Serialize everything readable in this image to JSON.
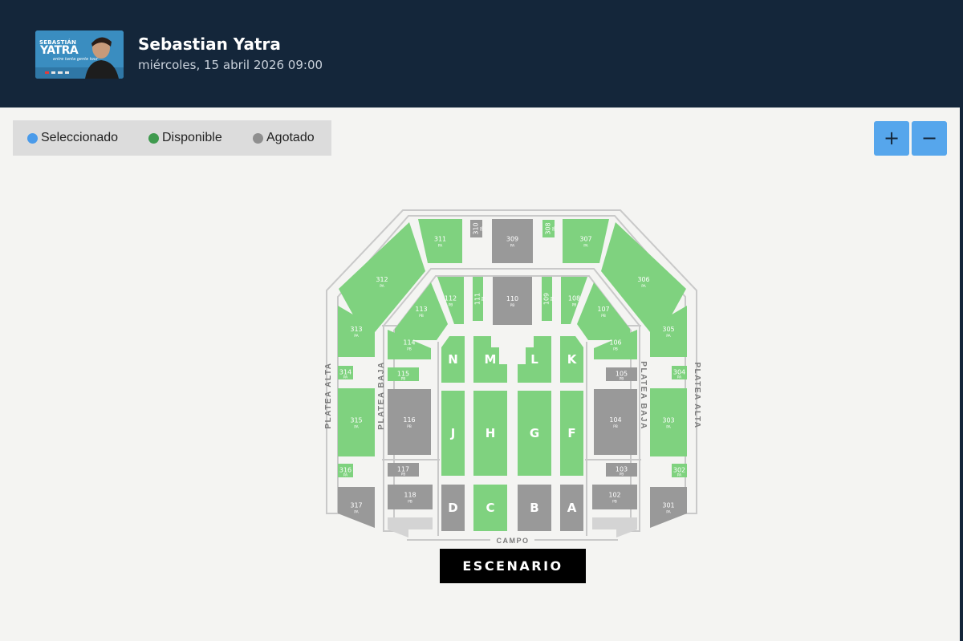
{
  "event": {
    "title": "Sebastian Yatra",
    "date": "miércoles, 15 abril 2026 09:00",
    "poster": {
      "line1": "SEBASTIÁN",
      "line2": "YATRA",
      "line3": "entre tanta gente tour"
    }
  },
  "legend": {
    "selected": {
      "label": "Seleccionado",
      "color": "#4a9bea"
    },
    "available": {
      "label": "Disponible",
      "color": "#3f9a4e"
    },
    "soldout": {
      "label": "Agotado",
      "color": "#8f8f8f"
    }
  },
  "zoom": {
    "in_label": "+",
    "out_label": "−"
  },
  "venue": {
    "stage_label": "ESCENARIO",
    "floor_label": "CAMPO",
    "ring_labels": {
      "upper_left": "PLATEA ALTA",
      "lower_left": "PLATEA BAJA",
      "lower_right": "PLATEA BAJA",
      "upper_right": "PLATEA ALTA"
    },
    "section_colors": {
      "available": "#7fd27f",
      "soldout": "#999999"
    },
    "sections": [
      {
        "name": "311",
        "sub": "PA",
        "status": "available"
      },
      {
        "name": "310",
        "sub": "PA",
        "status": "soldout"
      },
      {
        "name": "309",
        "sub": "PA",
        "status": "soldout"
      },
      {
        "name": "308",
        "sub": "PA",
        "status": "available"
      },
      {
        "name": "307",
        "sub": "PA",
        "status": "available"
      },
      {
        "name": "312",
        "sub": "PA",
        "status": "available"
      },
      {
        "name": "306",
        "sub": "PA",
        "status": "available"
      },
      {
        "name": "112",
        "sub": "PB",
        "status": "available"
      },
      {
        "name": "111",
        "sub": "PB",
        "status": "available"
      },
      {
        "name": "110",
        "sub": "PB",
        "status": "soldout"
      },
      {
        "name": "109",
        "sub": "PB",
        "status": "available"
      },
      {
        "name": "108",
        "sub": "PB",
        "status": "available"
      },
      {
        "name": "113",
        "sub": "PB",
        "status": "available"
      },
      {
        "name": "107",
        "sub": "PB",
        "status": "available"
      },
      {
        "name": "313",
        "sub": "PA",
        "status": "available"
      },
      {
        "name": "305",
        "sub": "PA",
        "status": "available"
      },
      {
        "name": "114",
        "sub": "PB",
        "status": "available"
      },
      {
        "name": "106",
        "sub": "PB",
        "status": "available"
      },
      {
        "name": "314",
        "sub": "PA",
        "status": "available"
      },
      {
        "name": "115",
        "sub": "PB",
        "status": "available"
      },
      {
        "name": "105",
        "sub": "PB",
        "status": "soldout"
      },
      {
        "name": "304",
        "sub": "PA",
        "status": "available"
      },
      {
        "name": "315",
        "sub": "PA",
        "status": "available"
      },
      {
        "name": "116",
        "sub": "PB",
        "status": "soldout"
      },
      {
        "name": "104",
        "sub": "PB",
        "status": "soldout"
      },
      {
        "name": "303",
        "sub": "PA",
        "status": "available"
      },
      {
        "name": "316",
        "sub": "PA",
        "status": "available"
      },
      {
        "name": "117",
        "sub": "PB",
        "status": "soldout"
      },
      {
        "name": "103",
        "sub": "PB",
        "status": "soldout"
      },
      {
        "name": "302",
        "sub": "PA",
        "status": "available"
      },
      {
        "name": "317",
        "sub": "PA",
        "status": "soldout"
      },
      {
        "name": "118",
        "sub": "PB",
        "status": "soldout"
      },
      {
        "name": "102",
        "sub": "PB",
        "status": "soldout"
      },
      {
        "name": "301",
        "sub": "PA",
        "status": "soldout"
      },
      {
        "name": "N",
        "status": "available"
      },
      {
        "name": "M",
        "status": "available"
      },
      {
        "name": "L",
        "status": "available"
      },
      {
        "name": "K",
        "status": "available"
      },
      {
        "name": "J",
        "status": "available"
      },
      {
        "name": "H",
        "status": "available"
      },
      {
        "name": "G",
        "status": "available"
      },
      {
        "name": "F",
        "status": "available"
      },
      {
        "name": "D",
        "status": "soldout"
      },
      {
        "name": "C",
        "status": "available"
      },
      {
        "name": "B",
        "status": "soldout"
      },
      {
        "name": "A",
        "status": "soldout"
      }
    ]
  }
}
